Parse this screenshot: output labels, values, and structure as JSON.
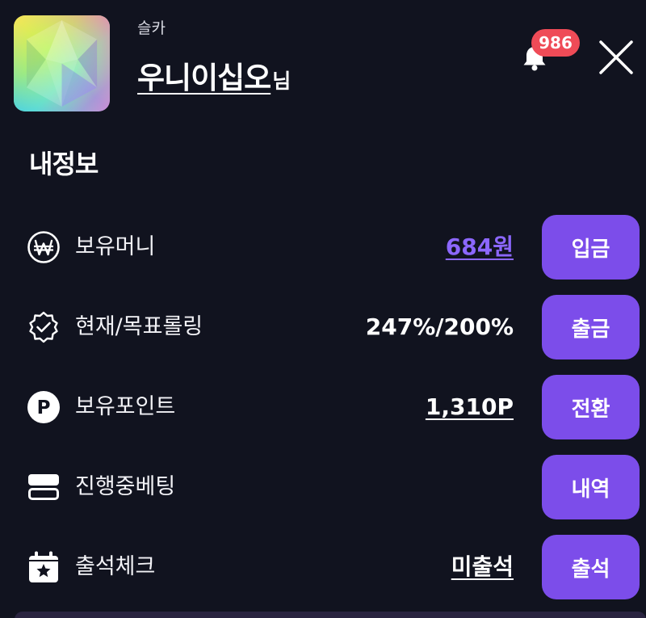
{
  "header": {
    "grade": "슬카",
    "nickname": "우니이십오",
    "honorific": "님",
    "notification_count": "986",
    "avatar_icon": "rainbow-gem-icon",
    "bell_icon": "bell-icon",
    "close_icon": "close-icon"
  },
  "section_title": "내정보",
  "rows": [
    {
      "icon": "won-icon",
      "label": "보유머니",
      "value": "684원",
      "button": "입금"
    },
    {
      "icon": "verified-badge-icon",
      "label": "현재/목표롤링",
      "value": "247%/200%",
      "button": "출금"
    },
    {
      "icon": "point-icon",
      "label": "보유포인트",
      "value": "1,310P",
      "button": "전환"
    },
    {
      "icon": "betting-list-icon",
      "label": "진행중베팅",
      "value": "",
      "button": "내역"
    },
    {
      "icon": "calendar-star-icon",
      "label": "출석체크",
      "value": "미출석",
      "button": "출석"
    }
  ],
  "colors": {
    "background": "#11131f",
    "button": "#7c4dea",
    "accent_link": "#8c67ff",
    "badge": "#ef4b57"
  }
}
